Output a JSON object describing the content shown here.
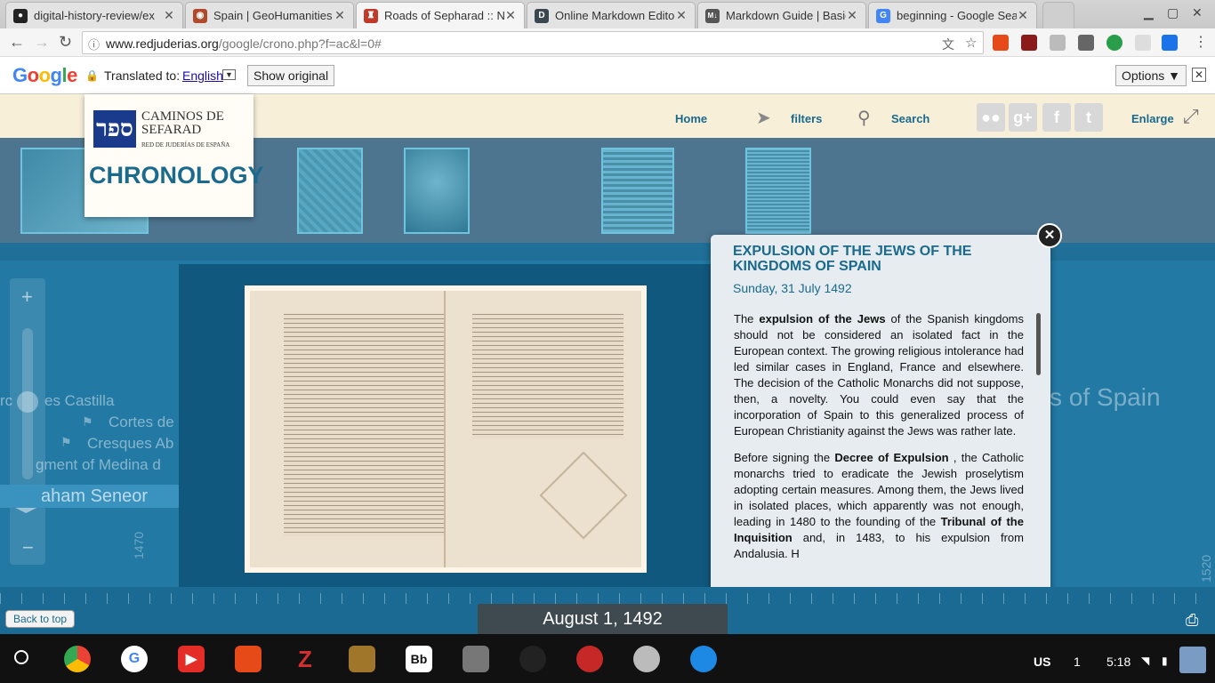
{
  "tabs": [
    {
      "title": "digital-history-review/ex",
      "favicon": "github-icon"
    },
    {
      "title": "Spain | GeoHumanities",
      "favicon": "geohumanities-icon"
    },
    {
      "title": "Roads of Sepharad :: Ne",
      "favicon": "sepharad-icon"
    },
    {
      "title": "Online Markdown Editor",
      "favicon": "dillinger-icon"
    },
    {
      "title": "Markdown Guide | Basic",
      "favicon": "markdown-icon"
    },
    {
      "title": "beginning - Google Sear",
      "favicon": "google-icon"
    }
  ],
  "address": {
    "host": "www.redjuderias.org",
    "path": "/google/crono.php?f=ac&l=0#"
  },
  "translate": {
    "logo": "Google",
    "label": "Translated to:",
    "language": "English",
    "show_original": "Show original",
    "options": "Options ▼"
  },
  "site": {
    "logo_line1": "CAMINOS DE",
    "logo_line2": "SEFARAD",
    "logo_line3": "RED DE JUDERÍAS DE ESPAÑA",
    "section_title": "CHRONOLOGY",
    "nav": {
      "home": "Home",
      "filters": "filters",
      "search": "Search",
      "enlarge": "Enlarge"
    }
  },
  "timeline": {
    "labels": [
      "rc",
      "es Castilla",
      "Cortes de",
      "Cresques Ab",
      "gment of Medina d",
      "aham Seneor",
      "s of Spain"
    ],
    "years": [
      "1470",
      "1520"
    ],
    "current_date": "August 1, 1492",
    "back_to_top": "Back to top",
    "zoom_in": "+",
    "zoom_out": "−"
  },
  "popup": {
    "title": "EXPULSION OF THE JEWS OF THE KINGDOMS OF SPAIN",
    "date": "Sunday, 31 July 1492",
    "p1_a": "The ",
    "p1_b": "expulsion of the Jews",
    "p1_c": " of the Spanish kingdoms should not be considered an isolated fact in the European context. The growing religious intolerance had led similar cases in England, France and elsewhere. The decision of the Catholic Monarchs did not suppose, then, a novelty. You could even say that the incorporation of Spain to this generalized process of European Christianity against the Jews was rather late.",
    "p2_a": "Before signing the ",
    "p2_b": "Decree of Expulsion",
    "p2_c": " , the Catholic monarchs tried to eradicate the Jewish proselytism adopting certain measures. Among them, the Jews lived in isolated places, which apparently was not enough, leading in 1480 to the founding of the ",
    "p2_d": "Tribunal of the Inquisition",
    "p2_e": " and, in 1483, to his expulsion from Andalusia. H"
  },
  "shelf": {
    "locale": "US",
    "notifications": "1",
    "clock": "5:18"
  },
  "colors": {
    "accent": "#1a6a8d",
    "main_bg": "#2279a4",
    "header_bg": "#f8efd9"
  }
}
